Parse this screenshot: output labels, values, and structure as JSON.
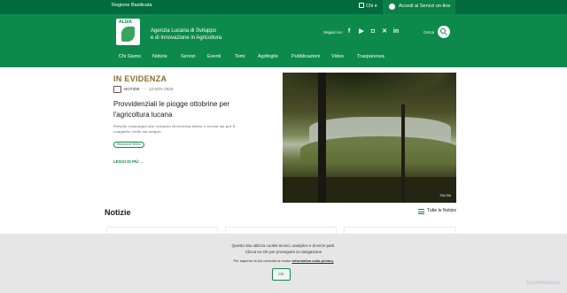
{
  "topbar": {
    "region": "Regione Basilicata",
    "chi": "Chi è",
    "access": "Accedi ai Servizi on-line"
  },
  "header": {
    "logo_text": "ALSIA",
    "agency_line1": "Agenzia Lucana di Sviluppo",
    "agency_line2": "e di Innovazione in Agricoltura",
    "follow_label": "Seguici su:",
    "social": [
      "facebook-icon",
      "youtube-icon",
      "instagram-icon",
      "x-icon",
      "linkedin-icon"
    ],
    "search_label": "Cerca"
  },
  "nav": [
    "Chi Siamo",
    "Notizie",
    "Servizi",
    "Eventi",
    "Temi",
    "Agrifoglio",
    "Pubblicazioni",
    "Video",
    "Trasparenza"
  ],
  "featured": {
    "section_title": "IN EVIDENZA",
    "category": "NOTIZIE",
    "date": "12 NOV 2023",
    "headline": "Provvidenziali le piogge ottobrine per l'agricoltura lucana",
    "summary": "Periodo comunque sito scenario di severità idrica e siccità sia per il comparto civile sia irriguo.",
    "tag": "Situazione Meteo",
    "read_more": "LEGGI DI PIÙ",
    "image_credit": "©ALSIA"
  },
  "news": {
    "title": "Notizie",
    "all_link": "Tutte le Notizie"
  },
  "cookie": {
    "line1": "Questo sito utilizza cookie tecnici, analytics e di terze parti.",
    "line2": "Clicca su OK per proseguire la navigazione",
    "info_prefix": "Per saperne di più consulta la nostra",
    "info_link": "informativa sulla privacy",
    "ok": "OK"
  },
  "watermark": "ScanMalware",
  "colors": {
    "primary_green": "#0d8a4b",
    "topbar_green": "#006b3c",
    "gold": "#8a6d2f"
  }
}
